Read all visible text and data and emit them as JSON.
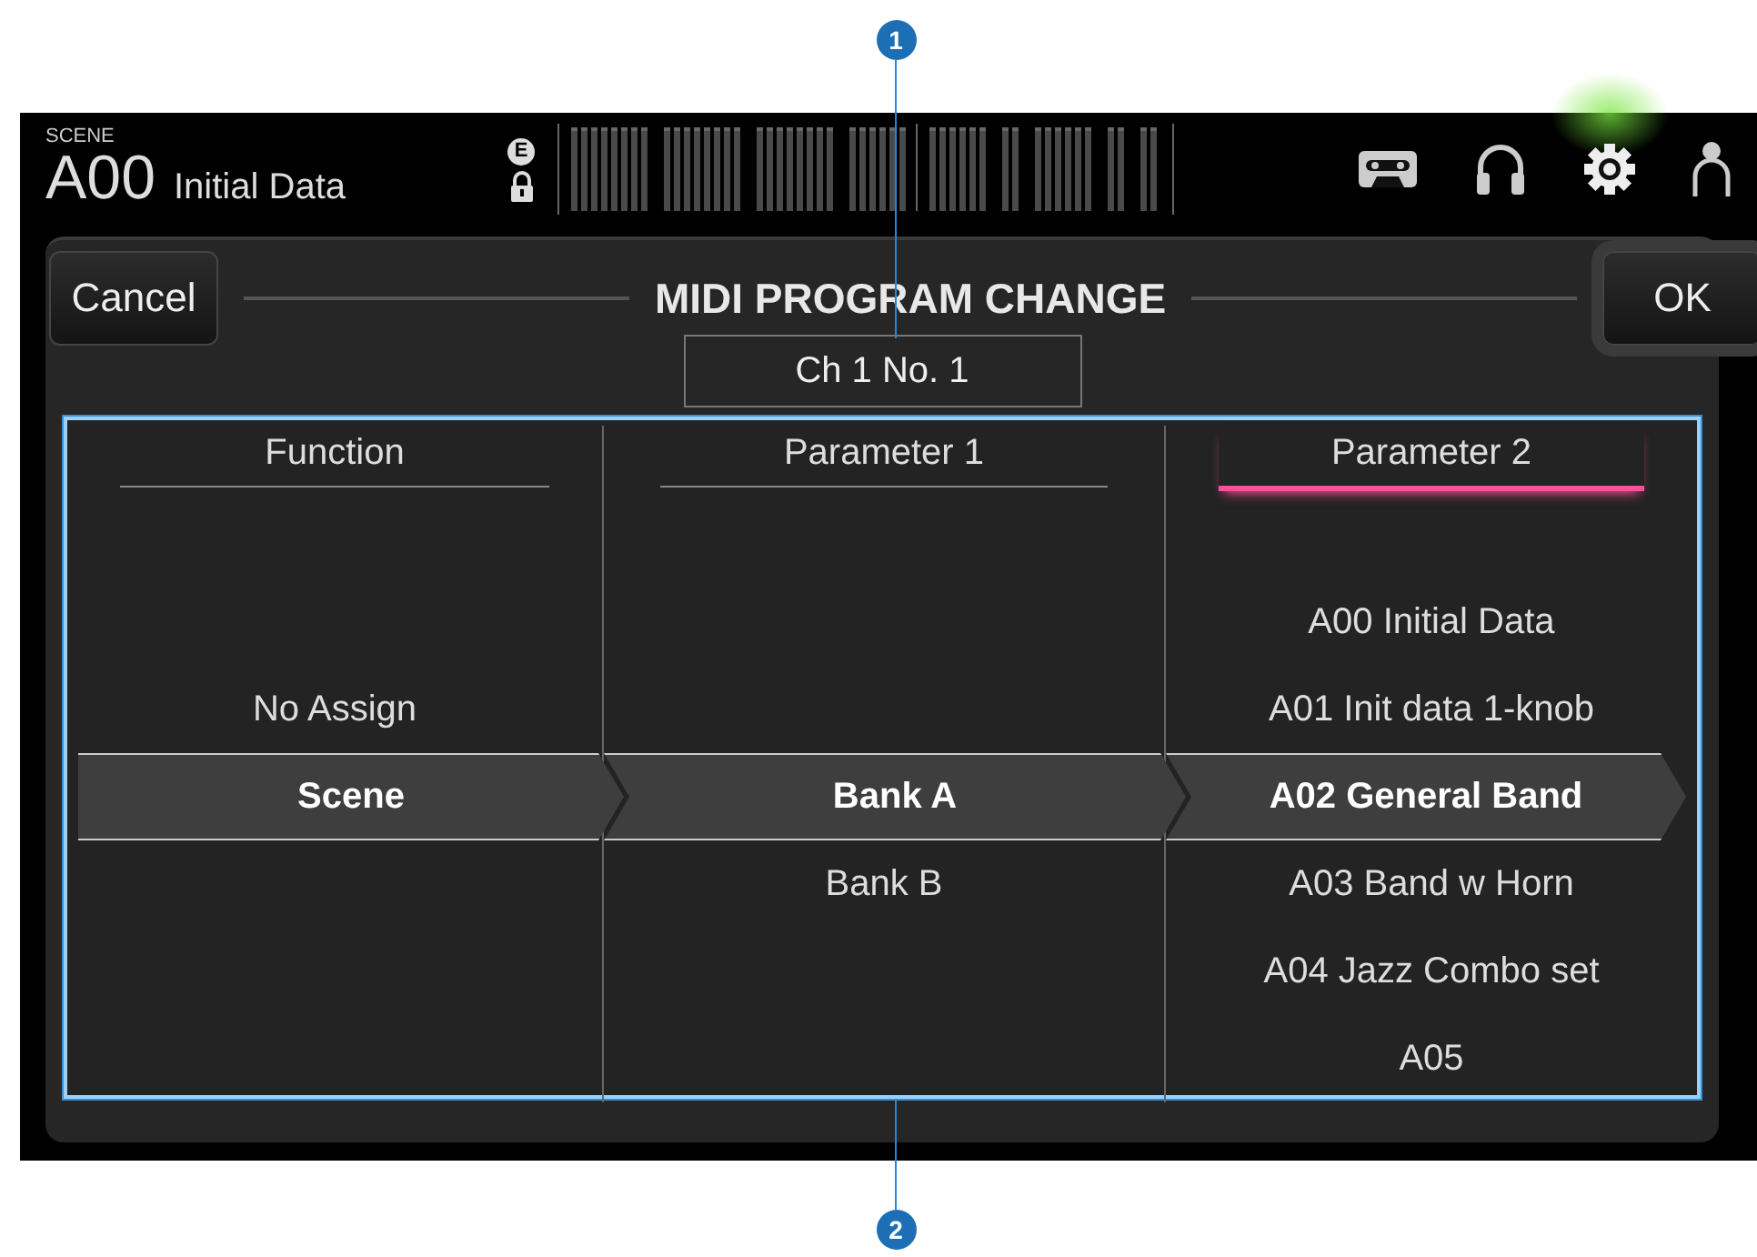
{
  "callouts": [
    {
      "number": "1"
    },
    {
      "number": "2"
    }
  ],
  "top_bar": {
    "scene_label": "SCENE",
    "scene_number": "A00",
    "scene_name": "Initial Data",
    "edit_mark": "E",
    "locked": true,
    "icons": [
      {
        "kind": "cassette",
        "selected": false
      },
      {
        "kind": "headphones",
        "selected": false
      },
      {
        "kind": "gear",
        "selected": true
      },
      {
        "kind": "person",
        "selected": false
      }
    ]
  },
  "dialog": {
    "cancel": "Cancel",
    "title": "MIDI PROGRAM CHANGE",
    "ok": "OK",
    "channel": "Ch 1 No. 1",
    "columns": [
      {
        "header": "Function",
        "active": false,
        "items": [
          {
            "label": "No Assign",
            "selected": false
          },
          {
            "label": "Scene",
            "selected": true
          }
        ]
      },
      {
        "header": "Parameter 1",
        "active": false,
        "items": [
          {
            "label": "Bank A",
            "selected": true
          },
          {
            "label": "Bank B",
            "selected": false
          }
        ]
      },
      {
        "header": "Parameter 2",
        "active": true,
        "items": [
          {
            "label": "A00 Initial Data",
            "selected": false
          },
          {
            "label": "A01 Init data 1-knob",
            "selected": false
          },
          {
            "label": "A02 General Band",
            "selected": true
          },
          {
            "label": "A03 Band w Horn",
            "selected": false
          },
          {
            "label": "A04 Jazz Combo set",
            "selected": false
          },
          {
            "label": "A05",
            "selected": false
          }
        ]
      }
    ]
  }
}
